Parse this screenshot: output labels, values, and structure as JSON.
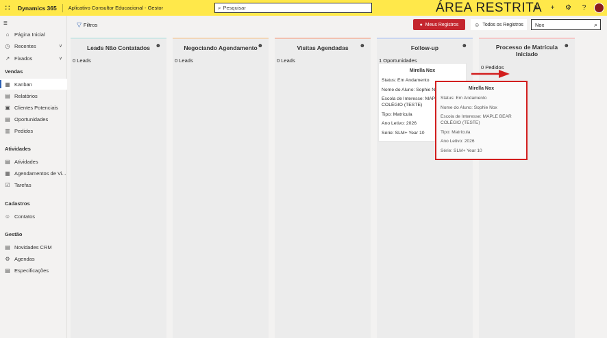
{
  "topbar": {
    "brand": "Dynamics 365",
    "app_name": "Aplicativo Consultor Educacional - Gestor",
    "search_placeholder": "Pesquisar",
    "banner": "ÁREA RESTRITA",
    "icons": [
      "lightbulb-icon",
      "plus-icon",
      "gear-icon",
      "help-icon",
      "user-avatar"
    ]
  },
  "sidebar": {
    "top_items": [
      {
        "label": "Página Inicial",
        "icon": "home-icon"
      },
      {
        "label": "Recentes",
        "icon": "clock-icon"
      },
      {
        "label": "Fixados",
        "icon": "pin-icon"
      }
    ],
    "groups": [
      {
        "title": "Vendas",
        "items": [
          {
            "label": "Kanban",
            "icon": "board-icon",
            "active": true
          },
          {
            "label": "Relatórios",
            "icon": "report-icon"
          },
          {
            "label": "Clientes Potenciais",
            "icon": "leads-icon"
          },
          {
            "label": "Oportunidades",
            "icon": "opportunity-icon"
          },
          {
            "label": "Pedidos",
            "icon": "orders-icon"
          }
        ]
      },
      {
        "title": "Atividades",
        "items": [
          {
            "label": "Atividades",
            "icon": "activities-icon"
          },
          {
            "label": "Agendamentos de Vi...",
            "icon": "calendar-icon"
          },
          {
            "label": "Tarefas",
            "icon": "tasks-icon"
          }
        ]
      },
      {
        "title": "Cadastros",
        "items": [
          {
            "label": "Contatos",
            "icon": "contact-icon"
          }
        ]
      },
      {
        "title": "Gestão",
        "items": [
          {
            "label": "Novidades CRM",
            "icon": "news-icon"
          },
          {
            "label": "Agendas",
            "icon": "agenda-gear-icon"
          },
          {
            "label": "Especificações",
            "icon": "spec-icon"
          }
        ]
      }
    ]
  },
  "toolbar": {
    "filters_label": "Filtros",
    "my_records_label": "Meus Registros",
    "all_records_label": "Todos os Registros",
    "search_value": "Nox"
  },
  "columns": [
    {
      "title": "Leads Não Contatados",
      "count": "0 Leads",
      "accent": "#cfe7e6"
    },
    {
      "title": "Negociando Agendamento",
      "count": "0 Leads",
      "accent": "#f2d6b8"
    },
    {
      "title": "Visitas Agendadas",
      "count": "0 Leads",
      "accent": "#f2c1b0"
    },
    {
      "title": "Follow-up",
      "count": "1 Oportunidades",
      "accent": "#c9d5f0"
    },
    {
      "title": "Processo de Matrícula Iniciado",
      "count": "0 Pedidos",
      "accent": "#f4c8c8"
    }
  ],
  "card": {
    "name": "Mirella Nox",
    "status": "Status: Em Andamento",
    "student": "Nome do Aluno: Sophie Nox",
    "school": "Escola de Interesse: MAPLE BEAR COLÉGIO (TESTE)",
    "type": "Tipo: Matrícula",
    "year": "Ano Letivo: 2026",
    "grade": "Série: SLM+ Year 10"
  },
  "popup": {
    "name": "Mirella Nox",
    "status": "Status: Em Andamento",
    "student": "Nome do Aluno: Sophie Nox",
    "school": "Escola de Interesse: MAPLE BEAR COLÉGIO (TESTE)",
    "type": "Tipo: Matrícula",
    "year": "Ano Letivo: 2026",
    "grade": "Série: SLM+ Year 10"
  },
  "colors": {
    "topbar": "#ffe84a",
    "highlight": "#d21e1e",
    "primary_button": "#c4262e"
  }
}
